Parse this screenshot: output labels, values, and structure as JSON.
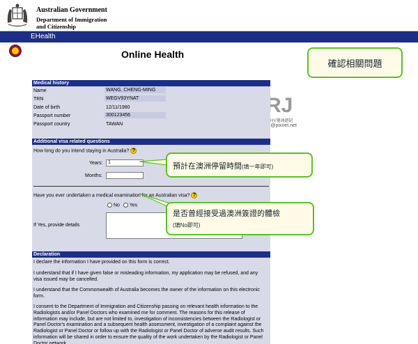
{
  "header": {
    "gov_line1": "Australian Government",
    "gov_line2": "Department of Immigration",
    "gov_line3": "and Citizenship",
    "app_bar": "EHealth"
  },
  "page": {
    "title": "Online Health"
  },
  "callouts": {
    "confirm": "確認相關問題",
    "stay": "預計在澳洲停留時間",
    "stay_note": "(填一年即可)",
    "exam_line1": "是否曾經接受過澳洲簽證的體檢",
    "exam_note": "(填No即可)"
  },
  "watermark": {
    "by": "By",
    "rj": "RJ",
    "line3": "2010.5WHV澳洲遊記",
    "line4": "rj1980@pixnet.net"
  },
  "medical_history": {
    "heading": "Medical history",
    "rows": [
      {
        "label": "Name",
        "value": "WANG, CHENG-MING"
      },
      {
        "label": "TRN",
        "value": "WEGV93YNAT"
      },
      {
        "label": "Date of birth",
        "value": "12/11/1980"
      },
      {
        "label": "Passport number",
        "value": "300123456"
      },
      {
        "label": "Passport country",
        "value": "TAWAN"
      }
    ]
  },
  "visa": {
    "heading": "Additional visa related questions",
    "stay_question": "How long do you intend staying in Australia?",
    "years_label": "Years:",
    "years_value": "1",
    "months_label": "Months:",
    "months_value": "",
    "exam_question": "Have you ever undertaken a medical examination for an Australian visa?",
    "no_label": "No",
    "yes_label": "Yes",
    "details_label": "If Yes, provide details"
  },
  "declaration": {
    "heading": "Declaration",
    "p1": "I declare the information I have provided on this form is correct.",
    "p2": "I understand that if I have given false or misleading information, my application may be refused, and any visa issued may be cancelled.",
    "p3": "I understand that the Commonwealth of Australia becomes the owner of the information on this electronic form.",
    "p4": "I consent to the Department of Immigration and Citizenship passing on relevant health information to the Radiologists and/or Panel Doctors who examined me for comment. The reasons for this release of information may include, but are not limited to, investigation of inconsistencies between the Radiologist or Panel Doctor's examination and a subsequent health assessment, investigation of a complaint against the Radiologist or Panel Doctor or follow up with the Radiologist or Panel Doctor of adverse audit results. Such information will be shared in order to ensure the quality of the work undertaken by the Radiologist or Panel Doctor network."
  },
  "colors": {
    "header_bar": "#1d2e86",
    "panel_bg": "#d8dae8",
    "callout_border": "#5bbf2a",
    "help_icon": "#f6d000"
  }
}
